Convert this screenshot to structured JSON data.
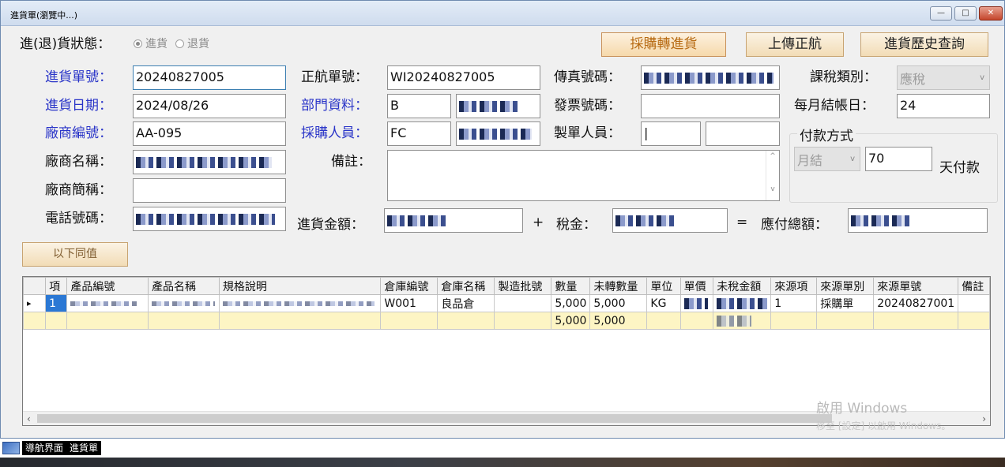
{
  "window": {
    "title": "進貨單(瀏覽中...)",
    "minimize_glyph": "—",
    "maximize_glyph": "□",
    "close_glyph": "✕"
  },
  "status": {
    "label": "進(退)貨狀態：",
    "options": [
      "進貨",
      "退貨"
    ],
    "selected": "進貨"
  },
  "buttons": {
    "purchase_to_receipt": "採購轉進貨",
    "upload": "上傳正航",
    "history": "進貨歷史查詢",
    "same_values": "以下同值"
  },
  "labels": {
    "receipt_no": "進貨單號：",
    "receipt_date": "進貨日期：",
    "vendor_code": "廠商編號：",
    "vendor_name": "廠商名稱：",
    "vendor_short": "廠商簡稱：",
    "phone": "電話號碼：",
    "zhenghang_no": "正航單號：",
    "department": "部門資料：",
    "buyer": "採購人員：",
    "remark": "備註：",
    "fax": "傳真號碼：",
    "invoice": "發票號碼：",
    "maker": "製單人員：",
    "tax_type": "課稅類別：",
    "closing_day": "每月結帳日：",
    "payment": "付款方式",
    "payment_days_suffix": "天付款",
    "amount": "進貨金額：",
    "plus": "+",
    "tax": "稅金：",
    "equals": "=",
    "total": "應付總額："
  },
  "fields": {
    "receipt_no": "20240827005",
    "receipt_date": "2024/08/26",
    "vendor_code": "AA-095",
    "vendor_short": "",
    "zhenghang_no": "WI20240827005",
    "department_code": "B",
    "buyer_code": "FC",
    "invoice": "",
    "maker_code": "|",
    "maker_name": "",
    "tax_type": "應稅",
    "closing_day": "24",
    "payment_method": "月結",
    "payment_days": "70"
  },
  "grid": {
    "columns": [
      "項",
      "產品編號",
      "產品名稱",
      "規格說明",
      "倉庫編號",
      "倉庫名稱",
      "製造批號",
      "數量",
      "未轉數量",
      "單位",
      "單價",
      "未稅金額",
      "來源項",
      "來源單別",
      "來源單號",
      "備註"
    ],
    "rows": [
      {
        "item": "1",
        "warehouse_code": "W001",
        "warehouse_name": "良品倉",
        "batch": "",
        "qty": "5,000",
        "unconverted": "5,000",
        "unit": "KG",
        "source_item": "1",
        "source_type": "採購單",
        "source_no": "20240827001",
        "remark": ""
      }
    ],
    "totals": {
      "qty": "5,000",
      "unconverted": "5,000"
    },
    "row_indicator": "▸",
    "scroll_left": "‹",
    "scroll_right": "›"
  },
  "watermark": {
    "line1": "啟用 Windows",
    "line2": "移至 [設定] 以啟用 Windows。"
  },
  "taskbar": {
    "items": [
      "導航界面",
      "進貨單"
    ]
  },
  "colors": {
    "blue_label": "#2a35c8",
    "button_orange": "#b76a12",
    "selection": "#2b78d4",
    "total_row": "#fdf5c4"
  },
  "icons": {
    "taskbar_start": "app-icon",
    "combo_arrow": "chevron-down-icon",
    "scroll_up": "chevron-up-icon",
    "scroll_down": "chevron-down-icon"
  }
}
